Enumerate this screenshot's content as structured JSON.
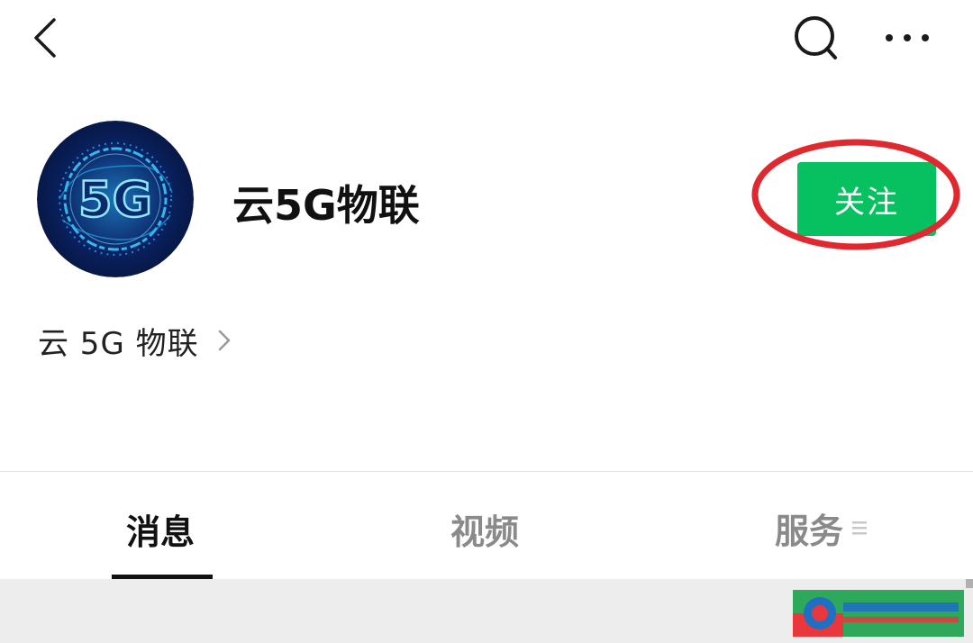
{
  "topbar": {
    "back_icon": "chevron-left-icon",
    "search_icon": "search-icon",
    "more_icon": "more-horizontal-icon"
  },
  "profile": {
    "avatar_text": "5G",
    "name": "云5G物联",
    "follow_label": "关注"
  },
  "subject": {
    "label": "云 5G 物联",
    "arrow_icon": "chevron-right-icon"
  },
  "tabs": [
    {
      "label": "消息",
      "active": true
    },
    {
      "label": "视频",
      "active": false
    },
    {
      "label": "服务",
      "active": false,
      "icon": "menu-icon"
    }
  ],
  "colors": {
    "follow_button": "#07c160",
    "highlight_ring": "#e0282f",
    "active_tab": "#111111",
    "inactive_tab": "#8a8a8a",
    "content_background": "#ededed"
  }
}
